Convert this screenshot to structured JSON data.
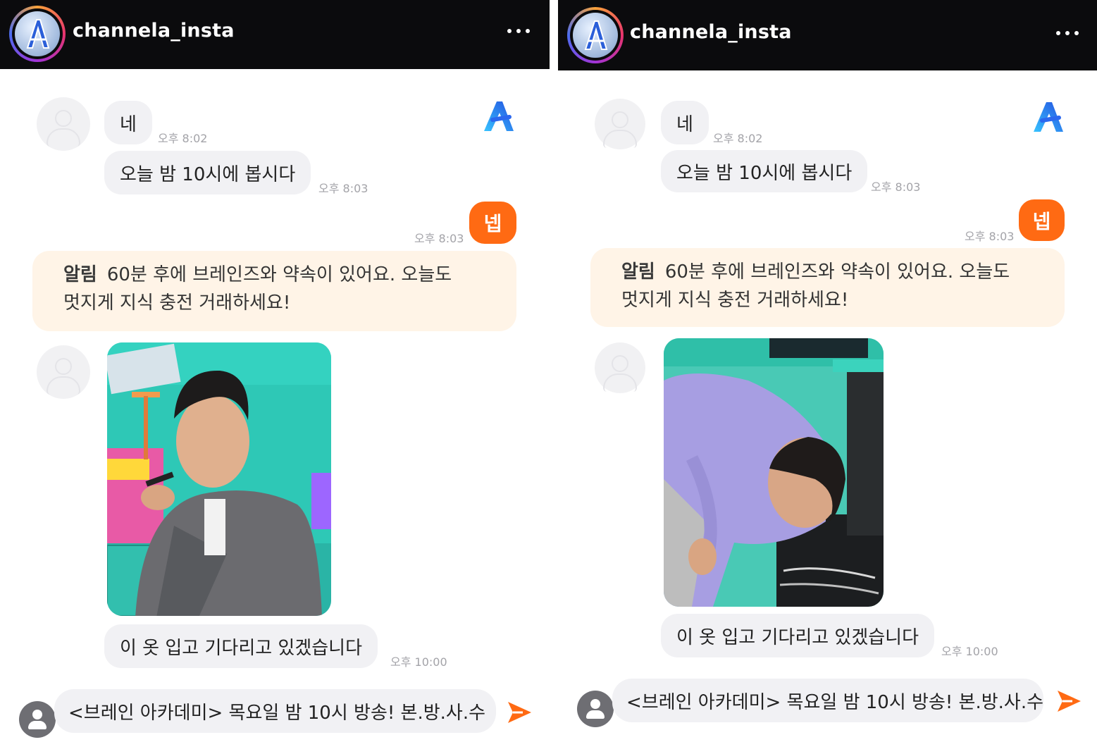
{
  "panels": [
    {
      "header": {
        "channel_name": "channela_insta",
        "more_icon": "more-horizontal-icon"
      },
      "messages": {
        "msg1": {
          "text": "네",
          "time": "오후 8:02"
        },
        "msg2": {
          "text": "오늘 밤 10시에 봅시다",
          "time": "오후 8:03"
        },
        "msg3": {
          "text": "넵",
          "time": "오후 8:03"
        },
        "notice": {
          "tag": "알림",
          "line1": "60분 후에 브레인즈와 약속이 있어요. 오늘도",
          "line2": "멋지게 지식 충전 거래하세요!"
        },
        "msg4": {
          "text": "이 옷 입고 기다리고 있겠습니다",
          "time": "오후 10:00"
        }
      },
      "input": {
        "value": "<브레인 아카데미> 목요일 밤 10시 방송! 본.방.사.수"
      }
    },
    {
      "header": {
        "channel_name": "channela_insta",
        "more_icon": "more-horizontal-icon"
      },
      "messages": {
        "msg1": {
          "text": "네",
          "time": "오후 8:02"
        },
        "msg2": {
          "text": "오늘 밤 10시에 봅시다",
          "time": "오후 8:03"
        },
        "msg3": {
          "text": "넵",
          "time": "오후 8:03"
        },
        "notice": {
          "tag": "알림",
          "line1": "60분 후에 브레인즈와 약속이 있어요. 오늘도",
          "line2": "멋지게 지식 충전 거래하세요!"
        },
        "msg4": {
          "text": "이 옷 입고 기다리고 있겠습니다",
          "time": "오후 10:00"
        }
      },
      "input": {
        "value": "<브레인 아카데미> 목요일 밤 10시 방송! 본.방.사.수"
      }
    }
  ],
  "colors": {
    "header_bg": "#0b0b0d",
    "accent": "#ff6a13",
    "bubble_bg": "#f1f1f4",
    "notice_bg": "#fff4e7",
    "brand_blue": "#2f7df0"
  }
}
